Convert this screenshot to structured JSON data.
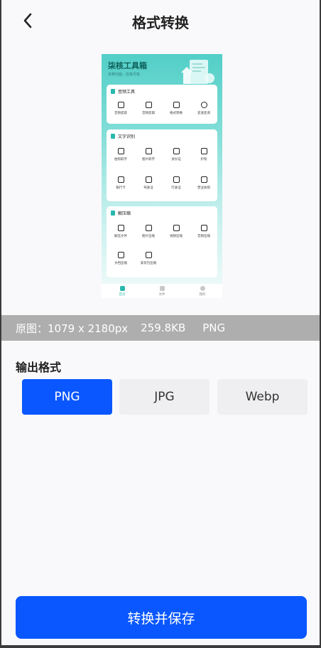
{
  "header": {
    "title": "格式转换",
    "back_icon": "chevron-left-icon"
  },
  "preview": {
    "app_title": "柒核工具箱",
    "app_subtitle": "多种功能，应有尽有",
    "sections": [
      {
        "title": "音频工具",
        "icon": "wrench-icon",
        "items": [
          {
            "label": "音频提取",
            "icon": "music-note-icon"
          },
          {
            "label": "音频剪辑",
            "icon": "scissors-icon"
          },
          {
            "label": "格式转换",
            "icon": "waveform-icon"
          },
          {
            "label": "变速变调",
            "icon": "gauge-icon"
          }
        ]
      },
      {
        "title": "文字识别",
        "icon": "document-icon",
        "items": [
          {
            "label": "拍照取字",
            "icon": "camera-icon"
          },
          {
            "label": "图片取字",
            "icon": "image-icon"
          },
          {
            "label": "身份证",
            "icon": "id-card-icon"
          },
          {
            "label": "护照",
            "icon": "passport-icon"
          },
          {
            "label": "银行卡",
            "icon": "bank-card-icon"
          },
          {
            "label": "驾驶证",
            "icon": "license-icon"
          },
          {
            "label": "行驶证",
            "icon": "car-icon"
          },
          {
            "label": "营业执照",
            "icon": "business-license-icon"
          }
        ]
      },
      {
        "title": "解压缩",
        "icon": "archive-icon",
        "items": [
          {
            "label": "解压文件",
            "icon": "zip-file-icon"
          },
          {
            "label": "图片压缩",
            "icon": "image-compress-icon"
          },
          {
            "label": "视频压缩",
            "icon": "video-compress-icon"
          },
          {
            "label": "音频压缩",
            "icon": "music-compress-icon"
          },
          {
            "label": "文档压缩",
            "icon": "doc-compress-icon"
          },
          {
            "label": "安装包压缩",
            "icon": "android-icon"
          }
        ]
      }
    ],
    "tabs": [
      {
        "label": "首页",
        "active": true
      },
      {
        "label": "文件",
        "active": false
      },
      {
        "label": "我的",
        "active": false
      }
    ]
  },
  "info": {
    "original_label": "原图：1079 x 2180px",
    "file_size": "259.8KB",
    "format": "PNG"
  },
  "output": {
    "label": "输出格式",
    "options": [
      {
        "label": "PNG",
        "selected": true
      },
      {
        "label": "JPG",
        "selected": false
      },
      {
        "label": "Webp",
        "selected": false
      }
    ]
  },
  "actions": {
    "save_label": "转换并保存"
  },
  "colors": {
    "accent": "#0a57ff",
    "preview_teal": "#28b8ad",
    "info_bar": "#aeaeae"
  }
}
